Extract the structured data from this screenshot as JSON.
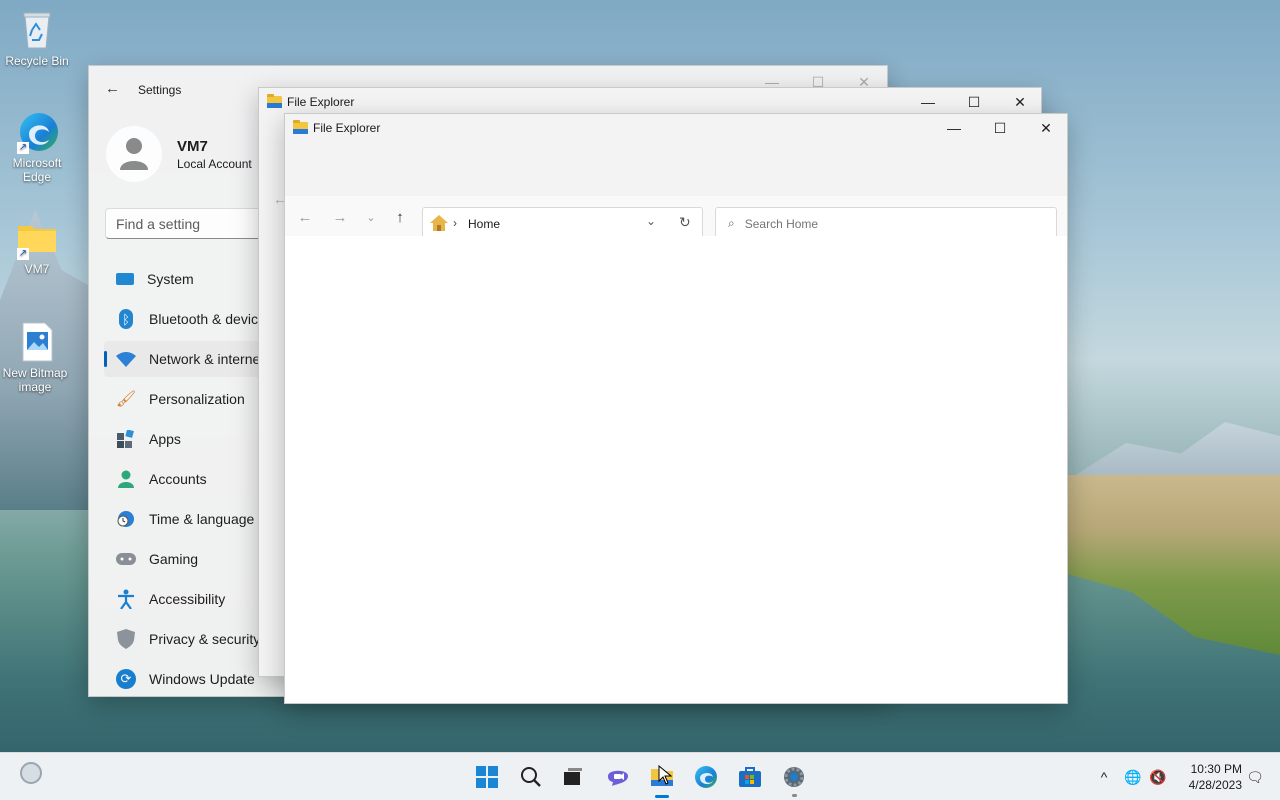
{
  "desktop": {
    "icons": [
      {
        "label": "Recycle Bin",
        "icon": "recycle-bin-icon"
      },
      {
        "label": "Microsoft Edge",
        "icon": "edge-icon"
      },
      {
        "label": "VM7",
        "icon": "folder-icon"
      },
      {
        "label": "New Bitmap image",
        "icon": "bitmap-file-icon"
      }
    ]
  },
  "settings": {
    "title": "Settings",
    "user_name": "VM7",
    "account_type": "Local Account",
    "search_placeholder": "Find a setting",
    "nav": [
      {
        "label": "System",
        "icon": "monitor-icon"
      },
      {
        "label": "Bluetooth & devices",
        "icon": "bluetooth-icon"
      },
      {
        "label": "Network & internet",
        "icon": "wifi-icon"
      },
      {
        "label": "Personalization",
        "icon": "paintbrush-icon"
      },
      {
        "label": "Apps",
        "icon": "apps-icon"
      },
      {
        "label": "Accounts",
        "icon": "person-icon"
      },
      {
        "label": "Time & language",
        "icon": "clock-globe-icon"
      },
      {
        "label": "Gaming",
        "icon": "gamepad-icon"
      },
      {
        "label": "Accessibility",
        "icon": "accessibility-icon"
      },
      {
        "label": "Privacy & security",
        "icon": "shield-icon"
      },
      {
        "label": "Windows Update",
        "icon": "sync-icon"
      }
    ],
    "active_index": 2
  },
  "explorer_back": {
    "title": "File Explorer"
  },
  "explorer": {
    "title": "File Explorer",
    "breadcrumb": "Home",
    "search_placeholder": "Search Home"
  },
  "taskbar": {
    "apps": [
      "start-icon",
      "search-icon",
      "task-view-icon",
      "chat-icon",
      "file-explorer-icon",
      "edge-icon",
      "store-icon",
      "settings-icon"
    ],
    "time": "10:30 PM",
    "date": "4/28/2023"
  },
  "colors": {
    "accent": "#0078d4",
    "window_bg": "#f3f3f3",
    "folder_yellow": "#f3c63f"
  }
}
